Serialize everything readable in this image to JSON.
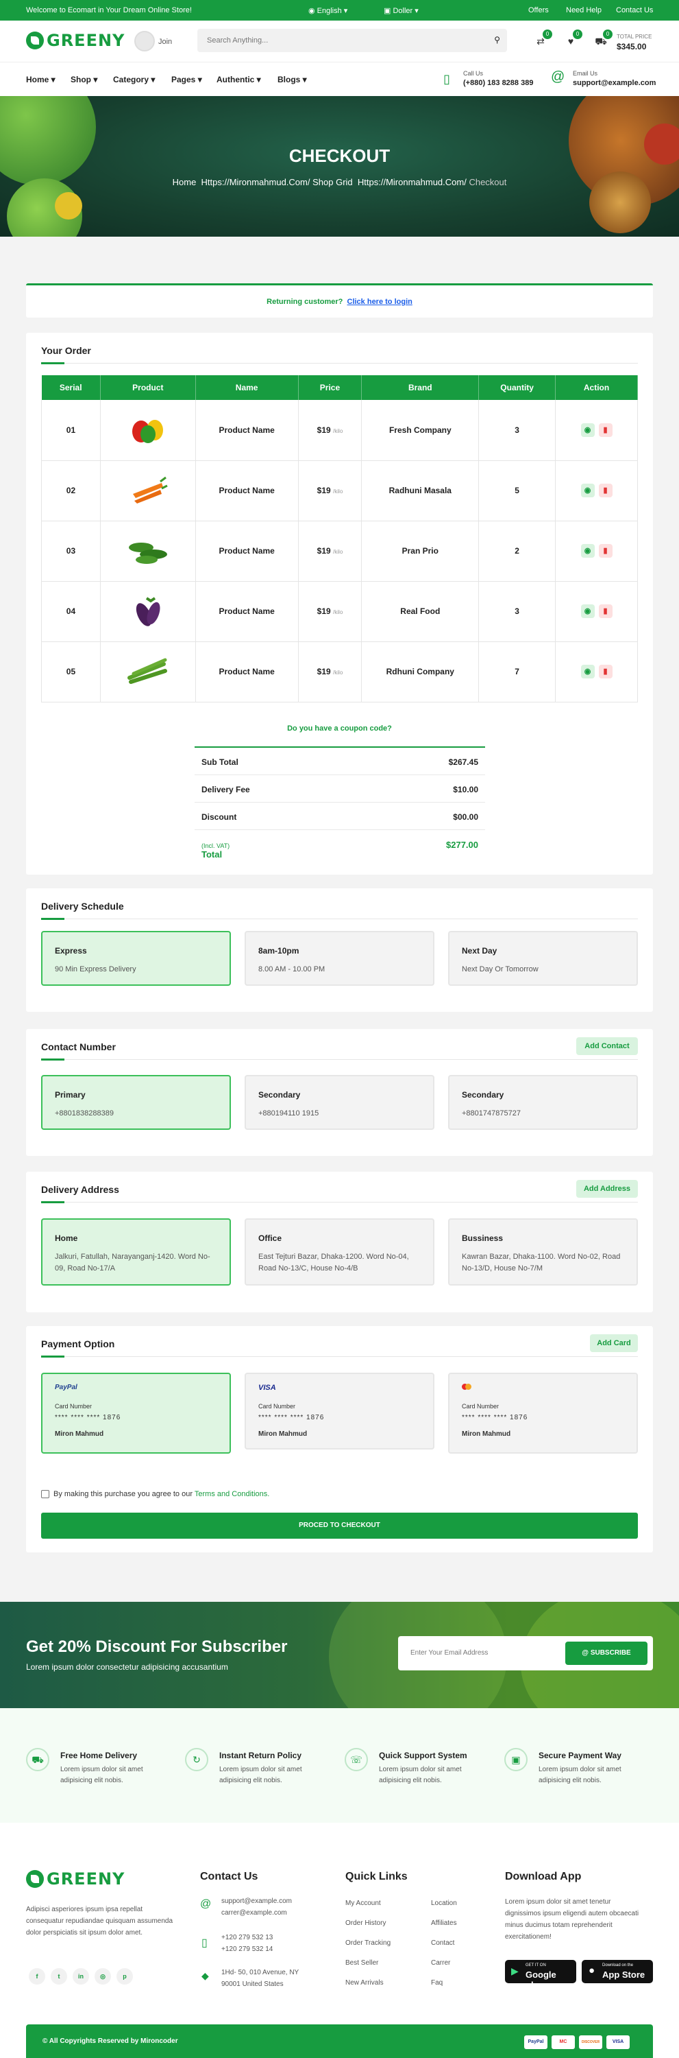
{
  "topbar": {
    "welcome": "Welcome to Ecomart in Your Dream Online Store!",
    "language": "English",
    "currency": "Doller",
    "offers": "Offers",
    "help": "Need Help",
    "contact": "Contact Us"
  },
  "header": {
    "logo": "GREENY",
    "join": "Join",
    "search_placeholder": "Search Anything...",
    "compare_count": "0",
    "wishlist_count": "0",
    "cart_count": "0",
    "total_label": "TOTAL PRICE",
    "total_value": "$345.00"
  },
  "nav": {
    "items": [
      "Home",
      "Shop",
      "Category",
      "Pages",
      "Authentic",
      "Blogs"
    ],
    "call_label": "Call Us",
    "call_value": "(+880) 183 8288 389",
    "email_label": "Email Us",
    "email_value": "support@example.com"
  },
  "hero": {
    "title": "CHECKOUT",
    "crumb_1": "Home",
    "crumb_2": "Https://Mironmahmud.Com/",
    "crumb_3": "Shop Grid",
    "crumb_4": "Https://Mironmahmud.Com/",
    "crumb_5": "Checkout"
  },
  "returning": {
    "text": "Returning customer?",
    "link": "Click here to login"
  },
  "order": {
    "title": "Your Order",
    "headers": [
      "Serial",
      "Product",
      "Name",
      "Price",
      "Brand",
      "Quantity",
      "Action"
    ],
    "rows": [
      {
        "serial": "01",
        "name": "Product Name",
        "price": "$19",
        "unit": "/kilo",
        "brand": "Fresh Company",
        "qty": "3"
      },
      {
        "serial": "02",
        "name": "Product Name",
        "price": "$19",
        "unit": "/kilo",
        "brand": "Radhuni Masala",
        "qty": "5"
      },
      {
        "serial": "03",
        "name": "Product Name",
        "price": "$19",
        "unit": "/kilo",
        "brand": "Pran Prio",
        "qty": "2"
      },
      {
        "serial": "04",
        "name": "Product Name",
        "price": "$19",
        "unit": "/kilo",
        "brand": "Real Food",
        "qty": "3"
      },
      {
        "serial": "05",
        "name": "Product Name",
        "price": "$19",
        "unit": "/kilo",
        "brand": "Rdhuni Company",
        "qty": "7"
      }
    ],
    "coupon": "Do you have a coupon code?",
    "subtotal_label": "Sub Total",
    "subtotal": "$267.45",
    "fee_label": "Delivery Fee",
    "fee": "$10.00",
    "discount_label": "Discount",
    "discount": "$00.00",
    "total_label": "Total",
    "total_note": "(Incl. VAT)",
    "total": "$277.00"
  },
  "schedule": {
    "title": "Delivery Schedule",
    "options": [
      {
        "title": "Express",
        "sub": "90 Min Express Delivery"
      },
      {
        "title": "8am-10pm",
        "sub": "8.00 AM - 10.00 PM"
      },
      {
        "title": "Next Day",
        "sub": "Next Day Or Tomorrow"
      }
    ]
  },
  "contact": {
    "title": "Contact Number",
    "add": "Add Contact",
    "options": [
      {
        "title": "Primary",
        "sub": "+8801838288389"
      },
      {
        "title": "Secondary",
        "sub": "+880194110 1915"
      },
      {
        "title": "Secondary",
        "sub": "+8801747875727"
      }
    ]
  },
  "address": {
    "title": "Delivery Address",
    "add": "Add Address",
    "options": [
      {
        "title": "Home",
        "sub": "Jalkuri, Fatullah, Narayanganj-1420. Word No-09, Road No-17/A"
      },
      {
        "title": "Office",
        "sub": "East Tejturi Bazar, Dhaka-1200. Word No-04, Road No-13/C, House No-4/B"
      },
      {
        "title": "Bussiness",
        "sub": "Kawran Bazar, Dhaka-1100. Word No-02, Road No-13/D, House No-7/M"
      }
    ]
  },
  "payment": {
    "title": "Payment Option",
    "add": "Add Card",
    "cards": [
      {
        "logo": "PayPal",
        "label": "Card Number",
        "number": "**** **** **** 1876",
        "name": "Miron Mahmud"
      },
      {
        "logo": "VISA",
        "label": "Card Number",
        "number": "**** **** **** 1876",
        "name": "Miron Mahmud"
      },
      {
        "logo": "",
        "label": "Card Number",
        "number": "**** **** **** 1876",
        "name": "Miron Mahmud"
      }
    ],
    "terms_text": "By making this purchase you agree to our",
    "terms_link": "Terms and Conditions.",
    "checkout": "PROCED TO CHECKOUT"
  },
  "subscribe": {
    "title": "Get 20% Discount For Subscriber",
    "sub": "Lorem ipsum dolor consectetur adipisicing accusantium",
    "placeholder": "Enter Your Email Address",
    "button": "SUBSCRIBE"
  },
  "features": [
    {
      "title": "Free Home Delivery",
      "desc": "Lorem ipsum dolor sit amet adipisicing elit nobis."
    },
    {
      "title": "Instant Return Policy",
      "desc": "Lorem ipsum dolor sit amet adipisicing elit nobis."
    },
    {
      "title": "Quick Support System",
      "desc": "Lorem ipsum dolor sit amet adipisicing elit nobis."
    },
    {
      "title": "Secure Payment Way",
      "desc": "Lorem ipsum dolor sit amet adipisicing elit nobis."
    }
  ],
  "footer": {
    "logo": "GREENY",
    "about": "Adipisci asperiores ipsum ipsa repellat consequatur repudiandae quisquam assumenda dolor perspiciatis sit ipsum dolor amet.",
    "contact_title": "Contact Us",
    "email1": "support@example.com",
    "email2": "carrer@example.com",
    "phone1": "+120 279 532 13",
    "phone2": "+120 279 532 14",
    "addr1": "1Hd- 50, 010 Avenue, NY",
    "addr2": "90001 United States",
    "links_title": "Quick Links",
    "links_col1": [
      "My Account",
      "Order History",
      "Order Tracking",
      "Best Seller",
      "New Arrivals"
    ],
    "links_col2": [
      "Location",
      "Affiliates",
      "Contact",
      "Carrer",
      "Faq"
    ],
    "app_title": "Download App",
    "app_text": "Lorem ipsum dolor sit amet tenetur dignissimos ipsum eligendi autem obcaecati minus ducimus totam reprehenderit exercitationem!",
    "gplay_small": "GET IT ON",
    "gplay": "Google play",
    "apple_small": "Download on the",
    "apple": "App Store",
    "copyright": "© All Copyrights Reserved by Mironcoder",
    "pay_logos": [
      "PayPal",
      "MC",
      "DISCOVER",
      "VISA"
    ]
  }
}
